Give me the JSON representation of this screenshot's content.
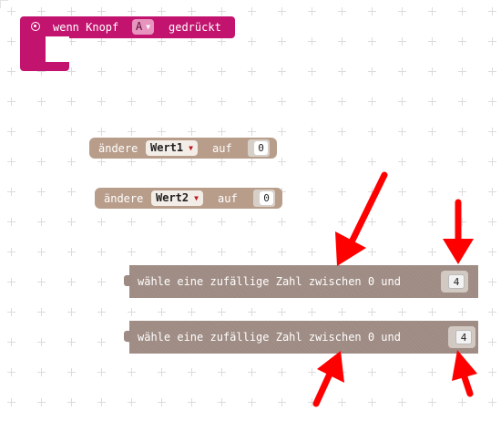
{
  "hat": {
    "prefix": "wenn Knopf",
    "dropdown": "A",
    "suffix": "gedrückt"
  },
  "set_blocks": [
    {
      "verb": "ändere",
      "variable": "Wert1",
      "connector": "auf",
      "value": "0"
    },
    {
      "verb": "ändere",
      "variable": "Wert2",
      "connector": "auf",
      "value": "0"
    }
  ],
  "random_blocks": [
    {
      "text": "wähle eine zufällige Zahl zwischen 0 und",
      "value": "4"
    },
    {
      "text": "wähle eine zufällige Zahl zwischen 0 und",
      "value": "4"
    }
  ],
  "colors": {
    "hat": "#c2146f",
    "variables": "#b89d8a",
    "math": "#9e8b83",
    "annotation_arrow": "#ff0000"
  },
  "icons": [
    "radio-icon",
    "dropdown-arrow-icon"
  ]
}
